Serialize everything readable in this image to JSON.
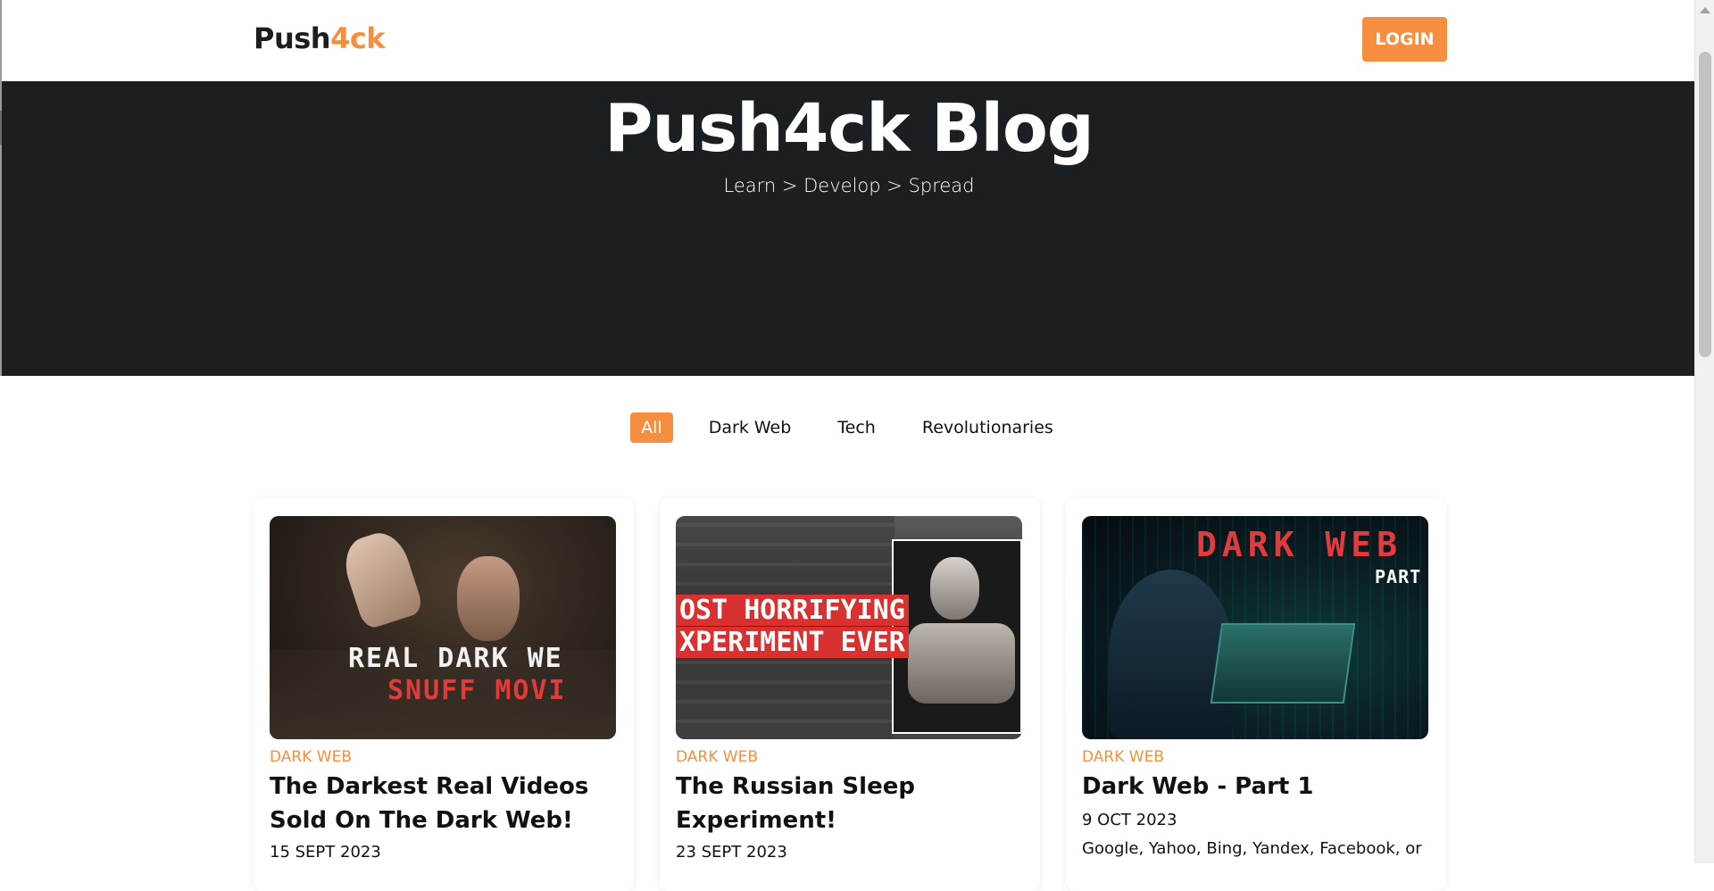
{
  "header": {
    "brand_main": "Push",
    "brand_accent": "4ck",
    "login_label": "LOGIN"
  },
  "hero": {
    "title": "Push4ck Blog",
    "subtitle": "Learn > Develop > Spread"
  },
  "filters": [
    {
      "label": "All",
      "active": true
    },
    {
      "label": "Dark Web",
      "active": false
    },
    {
      "label": "Tech",
      "active": false
    },
    {
      "label": "Revolutionaries",
      "active": false
    }
  ],
  "posts": [
    {
      "category": "DARK WEB",
      "title": "The Darkest Real Videos Sold On The Dark Web!",
      "date": "15 SEPT 2023",
      "image_text_1": "REAL DARK WE",
      "image_text_2": "SNUFF MOVI"
    },
    {
      "category": "DARK WEB",
      "title": "The Russian Sleep Experiment!",
      "date": "23 SEPT 2023",
      "image_text_1": "OST HORRIFYING",
      "image_text_2": "XPERIMENT EVER"
    },
    {
      "category": "DARK WEB",
      "title": "Dark Web - Part 1",
      "date": "9 OCT 2023",
      "excerpt": "Google, Yahoo, Bing, Yandex, Facebook, or",
      "image_text_1": "DARK WEB",
      "image_text_2": "PART"
    }
  ],
  "colors": {
    "accent": "#f58f3f",
    "hero_bg": "#1c1f22",
    "text": "#111111"
  }
}
